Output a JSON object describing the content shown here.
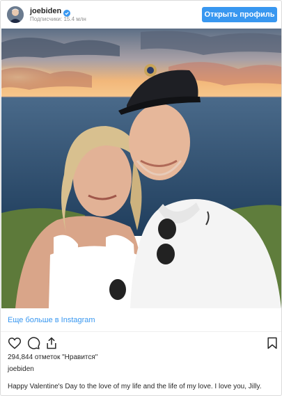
{
  "header": {
    "username": "joebiden",
    "followers_label": "Подписчики: 15.4 млн",
    "profile_button": "Открыть профиль"
  },
  "post": {
    "view_more": "Еще больше в Instagram",
    "likes": "294,844 отметок \"Нравится\"",
    "caption_user": "joebiden",
    "caption_text": "Happy Valentine's Day to the love of my life and the life of my love. I love you, Jilly."
  },
  "icons": {
    "verified": "verified-badge-icon",
    "like": "heart-icon",
    "comment": "comment-icon",
    "share": "share-icon",
    "save": "bookmark-icon"
  },
  "colors": {
    "accent": "#3897f0",
    "text": "#262626",
    "muted": "#8e8e8e"
  }
}
